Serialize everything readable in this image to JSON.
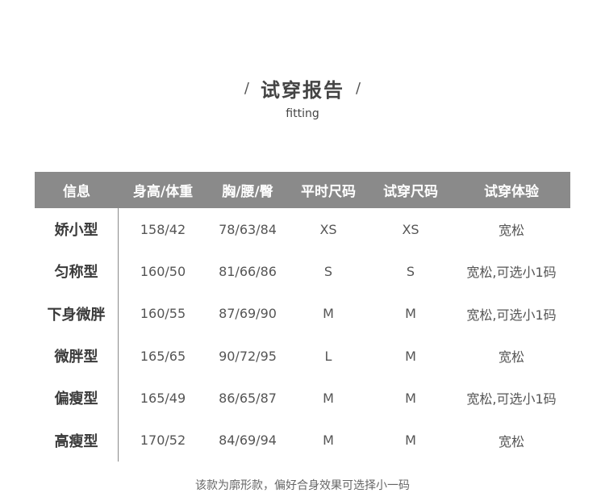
{
  "heading": {
    "slash_left": "/",
    "title": "试穿报告",
    "slash_right": "/",
    "subtitle": "fitting"
  },
  "table": {
    "columns": [
      "信息",
      "身高/体重",
      "胸/腰/臀",
      "平时尺码",
      "试穿尺码",
      "试穿体验"
    ],
    "rows": [
      [
        "娇小型",
        "158/42",
        "78/63/84",
        "XS",
        "XS",
        "宽松"
      ],
      [
        "匀称型",
        "160/50",
        "81/66/86",
        "S",
        "S",
        "宽松,可选小1码"
      ],
      [
        "下身微胖",
        "160/55",
        "87/69/90",
        "M",
        "M",
        "宽松,可选小1码"
      ],
      [
        "微胖型",
        "165/65",
        "90/72/95",
        "L",
        "M",
        "宽松"
      ],
      [
        "偏瘦型",
        "165/49",
        "86/65/87",
        "M",
        "M",
        "宽松,可选小1码"
      ],
      [
        "高瘦型",
        "170/52",
        "84/69/94",
        "M",
        "M",
        "宽松"
      ]
    ]
  },
  "footer": {
    "note": "该款为廓形款，偏好合身效果可选择小一码"
  },
  "colors": {
    "header_bg": "#8a8a8a",
    "header_text": "#ffffff",
    "body_text": "#555555"
  }
}
